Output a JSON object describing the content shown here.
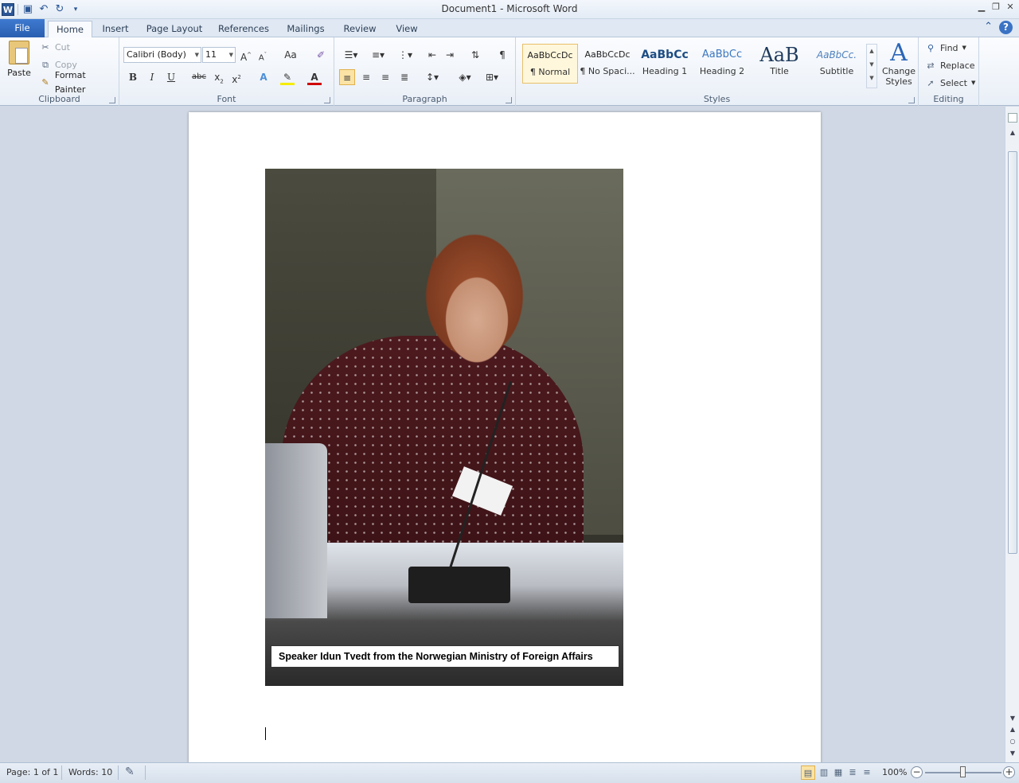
{
  "window": {
    "title": "Document1 - Microsoft Word"
  },
  "tabs": [
    {
      "label": "File"
    },
    {
      "label": "Home"
    },
    {
      "label": "Insert"
    },
    {
      "label": "Page Layout"
    },
    {
      "label": "References"
    },
    {
      "label": "Mailings"
    },
    {
      "label": "Review"
    },
    {
      "label": "View"
    }
  ],
  "clipboard": {
    "paste": "Paste",
    "cut": "Cut",
    "copy": "Copy",
    "format_painter": "Format Painter",
    "group": "Clipboard"
  },
  "font": {
    "name": "Calibri (Body)",
    "size": "11",
    "group": "Font",
    "bold": "B",
    "italic": "I",
    "underline": "U",
    "strike": "abc",
    "case": "Aa"
  },
  "paragraph": {
    "group": "Paragraph",
    "pilcrow": "¶"
  },
  "styles": {
    "group": "Styles",
    "items": [
      {
        "sample": "AaBbCcDc",
        "name": "¶ Normal"
      },
      {
        "sample": "AaBbCcDc",
        "name": "¶ No Spaci..."
      },
      {
        "sample": "AaBbCc",
        "name": "Heading 1"
      },
      {
        "sample": "AaBbCc",
        "name": "Heading 2"
      },
      {
        "sample": "AaB",
        "name": "Title"
      },
      {
        "sample": "AaBbCc.",
        "name": "Subtitle"
      }
    ],
    "change_line1": "Change",
    "change_line2": "Styles"
  },
  "editing": {
    "group": "Editing",
    "find": "Find",
    "replace": "Replace",
    "select": "Select"
  },
  "document": {
    "caption": "Speaker Idun Tvedt from the Norwegian Ministry of Foreign Affairs"
  },
  "status": {
    "page": "Page: 1 of 1",
    "words": "Words: 10",
    "zoom": "100%"
  },
  "colors": {
    "file_tab": "#2a5fb0",
    "accent": "#2b5797",
    "selected_style": "#fff7dc"
  }
}
